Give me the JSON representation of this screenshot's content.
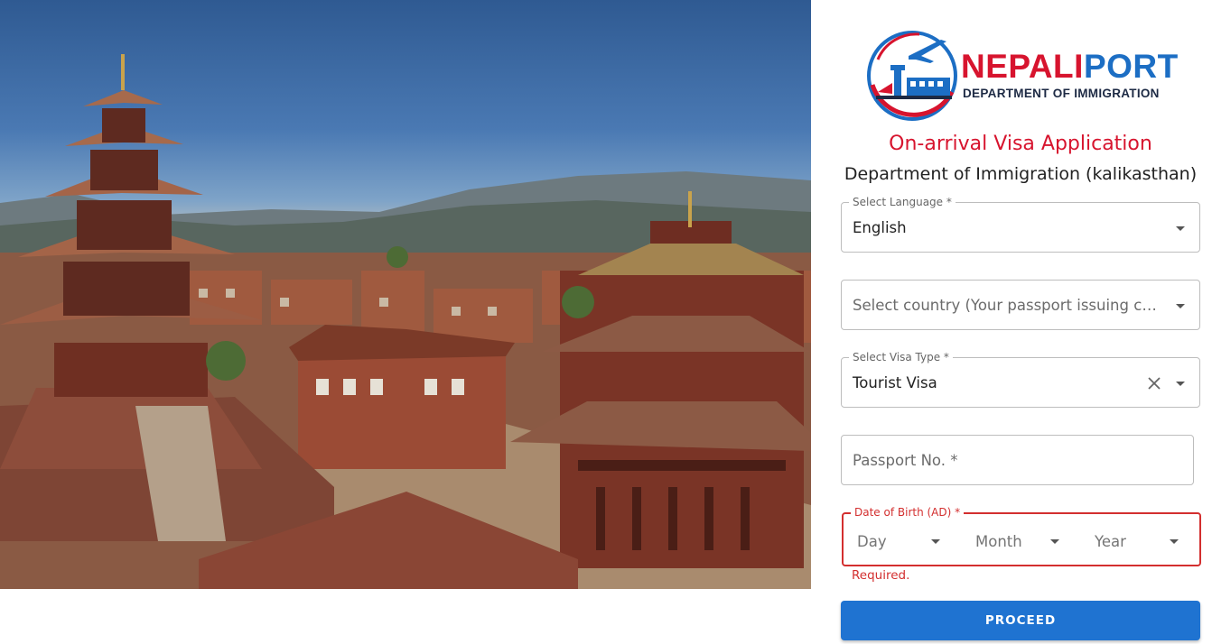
{
  "brand": {
    "name_part1": "NEPALI",
    "name_part2": "PORT",
    "department": "DEPARTMENT OF IMMIGRATION",
    "color_red": "#d7142e",
    "color_blue": "#1c6ec4"
  },
  "form": {
    "title": "On-arrival Visa Application",
    "subtitle": "Department of Immigration (kalikasthan)",
    "language": {
      "label": "Select Language *",
      "value": "English"
    },
    "country": {
      "placeholder": "Select country (Your passport issuing coun..."
    },
    "visa_type": {
      "label": "Select Visa Type *",
      "value": "Tourist Visa"
    },
    "passport": {
      "placeholder": "Passport No. *"
    },
    "dob": {
      "label": "Date of Birth (AD) *",
      "day": "Day",
      "month": "Month",
      "year": "Year",
      "error": "Required."
    },
    "proceed_label": "PROCEED"
  },
  "icons": {
    "dropdown": "chevron-down-icon",
    "clear": "close-icon"
  },
  "colors": {
    "primary_button": "#1f73d1",
    "error": "#d32f2f"
  }
}
